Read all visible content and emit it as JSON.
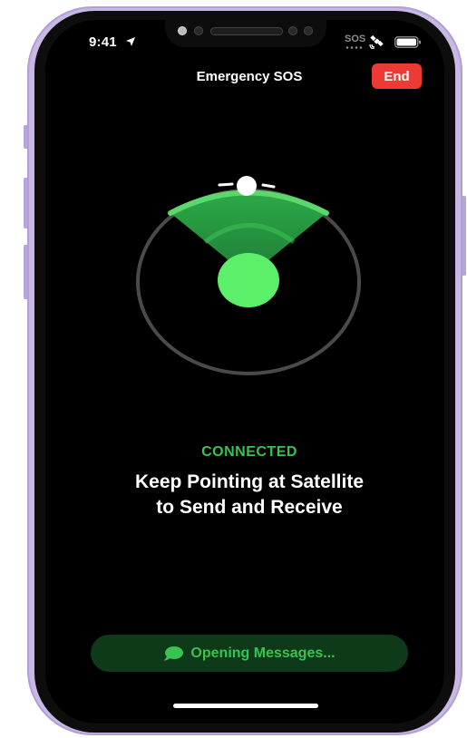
{
  "status_bar": {
    "time": "9:41",
    "sos": "SOS",
    "icons": [
      "location-arrow-icon",
      "satellite-icon",
      "battery-icon"
    ]
  },
  "header": {
    "title": "Emergency SOS",
    "end_label": "End"
  },
  "main": {
    "status": "CONNECTED",
    "instruction_line1": "Keep Pointing at Satellite",
    "instruction_line2": "to Send and Receive"
  },
  "bottom": {
    "messages_label": "Opening Messages...",
    "icon": "message-bubble-icon"
  },
  "colors": {
    "accent_green": "#38c24f",
    "end_red": "#ee3a34",
    "frame_lavender": "#c9b7e4",
    "button_dark_green": "#0f3a1a"
  }
}
